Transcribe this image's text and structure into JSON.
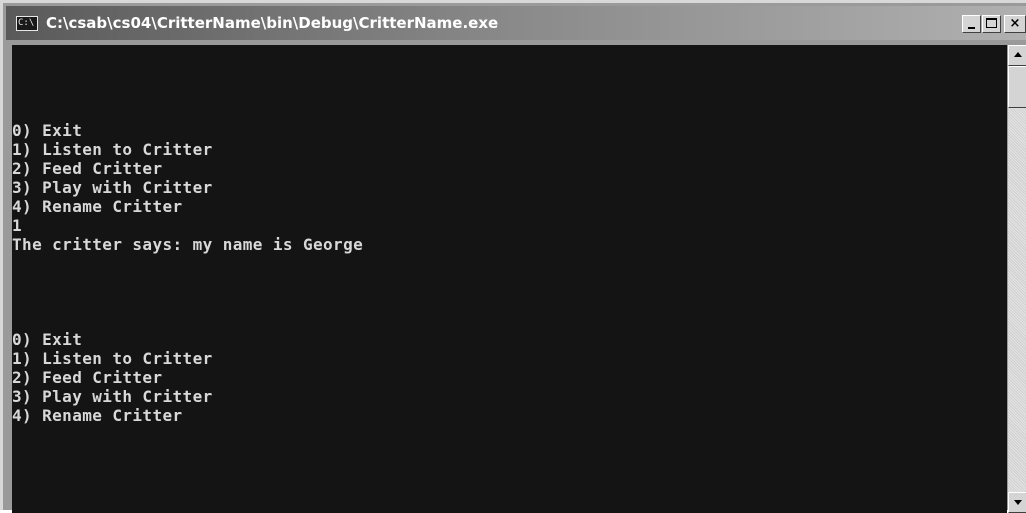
{
  "window": {
    "title": "C:\\csab\\cs04\\CritterName\\bin\\Debug\\CritterName.exe",
    "icon": "console-app-icon",
    "icon_glyph": "C:\\"
  },
  "console": {
    "lines": [
      "",
      "",
      "",
      "",
      "0) Exit",
      "1) Listen to Critter",
      "2) Feed Critter",
      "3) Play with Critter",
      "4) Rename Critter",
      "1",
      "The critter says: my name is George",
      "",
      "",
      "",
      "",
      "0) Exit",
      "1) Listen to Critter",
      "2) Feed Critter",
      "3) Play with Critter",
      "4) Rename Critter"
    ],
    "text_color": "#d8d8d8",
    "background_color": "#141414"
  }
}
